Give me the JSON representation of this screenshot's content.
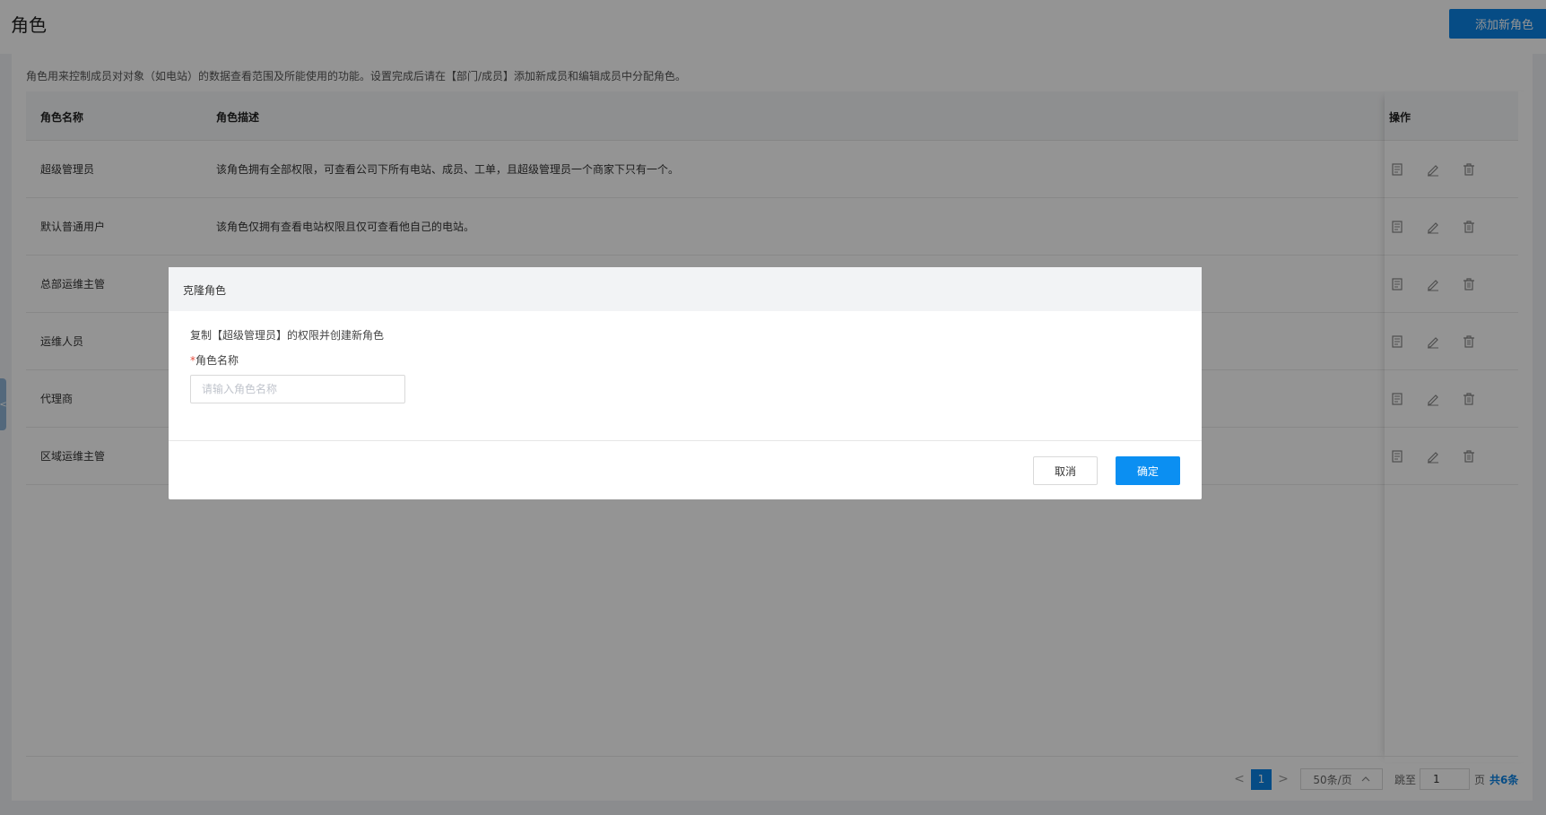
{
  "page": {
    "title": "角色",
    "add_button": "添加新角色",
    "intro": "角色用来控制成员对对象（如电站）的数据查看范围及所能使用的功能。设置完成后请在【部门/成员】添加新成员和编辑成员中分配角色。"
  },
  "table": {
    "columns": [
      "角色名称",
      "角色描述",
      "操作"
    ],
    "rows": [
      {
        "name": "超级管理员",
        "desc": "该角色拥有全部权限，可查看公司下所有电站、成员、工单，且超级管理员一个商家下只有一个。"
      },
      {
        "name": "默认普通用户",
        "desc": "该角色仅拥有查看电站权限且仅可查看他自己的电站。"
      },
      {
        "name": "总部运维主管",
        "desc": ""
      },
      {
        "name": "运维人员",
        "desc": ""
      },
      {
        "name": "代理商",
        "desc": ""
      },
      {
        "name": "区域运维主管",
        "desc": ""
      }
    ],
    "row_actions": [
      "copy-icon",
      "edit-icon",
      "delete-icon"
    ]
  },
  "pagination": {
    "prev": "<",
    "current": "1",
    "next": ">",
    "page_size": "50条/页",
    "jump_label": "跳至",
    "jump_value": "1",
    "page_unit": "页",
    "total": "共6条"
  },
  "side_tab": "<",
  "modal": {
    "title": "克隆角色",
    "description": "复制【超级管理员】的权限并创建新角色",
    "required_mark": "*",
    "field_label": "角色名称",
    "input_placeholder": "请输入角色名称",
    "cancel": "取消",
    "confirm": "确定"
  },
  "colors": {
    "primary": "#0b83e6",
    "confirm": "#0b8ff2",
    "required": "#e74c3c"
  }
}
